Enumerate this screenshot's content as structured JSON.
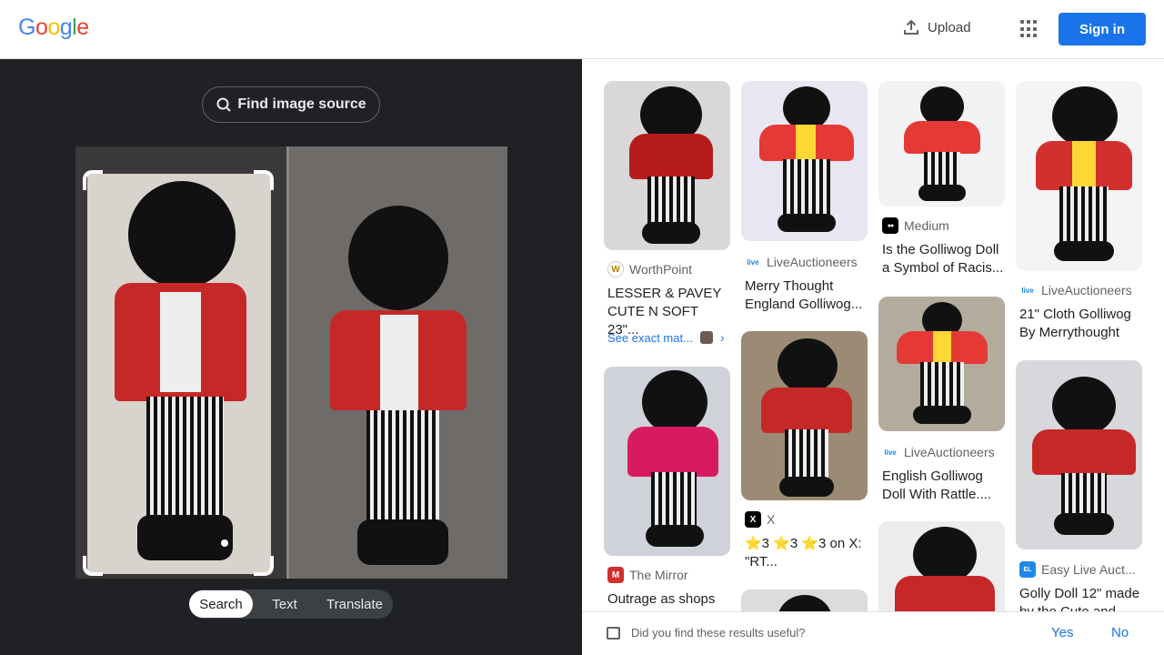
{
  "header": {
    "logo_letters": [
      {
        "ch": "G",
        "color": "#4285F4"
      },
      {
        "ch": "o",
        "color": "#EA4335"
      },
      {
        "ch": "o",
        "color": "#FBBC05"
      },
      {
        "ch": "g",
        "color": "#4285F4"
      },
      {
        "ch": "l",
        "color": "#34A853"
      },
      {
        "ch": "e",
        "color": "#EA4335"
      }
    ],
    "upload_label": "Upload",
    "apps_icon": "grid-icon",
    "signin_label": "Sign in"
  },
  "left": {
    "find_source_label": "Find image source",
    "tabs": [
      "Search",
      "Text",
      "Translate"
    ],
    "active_tab": "Search"
  },
  "results": [
    {
      "source": "WorthPoint",
      "favicon": "W",
      "fav_bg": "#fff",
      "fav_fg": "#b8860b",
      "title": "LESSER & PAVEY CUTE N SOFT 23\"...",
      "exact": "See exact mat..."
    },
    {
      "source": "The Mirror",
      "favicon": "M",
      "fav_bg": "#d32f2f",
      "fav_fg": "#fff",
      "title": "Outrage as shops"
    },
    {
      "source": "LiveAuctioneers",
      "favicon": "live",
      "fav_bg": "#fff",
      "fav_fg": "#1e88e5",
      "title": "Merry Thought England Golliwog..."
    },
    {
      "source": "X",
      "favicon": "X",
      "fav_bg": "#000",
      "fav_fg": "#fff",
      "title": "⭐3 ⭐3 ⭐3 on X: \"RT..."
    },
    {
      "source": "Medium",
      "favicon": "●●",
      "fav_bg": "#000",
      "fav_fg": "#fff",
      "title": "Is the Golliwog Doll a Symbol of Racis..."
    },
    {
      "source": "LiveAuctioneers",
      "favicon": "live",
      "fav_bg": "#fff",
      "fav_fg": "#1e88e5",
      "title": "English Golliwog Doll With Rattle...."
    },
    {
      "source": "LiveAuctioneers",
      "favicon": "live",
      "fav_bg": "#fff",
      "fav_fg": "#1e88e5",
      "title": "21\" Cloth Golliwog By Merrythought"
    },
    {
      "source": "Easy Live Auct...",
      "favicon": "EL",
      "fav_bg": "#1e88e5",
      "fav_fg": "#fff",
      "title": "Golly Doll 12\" made by the Cute and"
    }
  ],
  "feedback": {
    "question": "Did you find these results useful?",
    "yes": "Yes",
    "no": "No"
  }
}
